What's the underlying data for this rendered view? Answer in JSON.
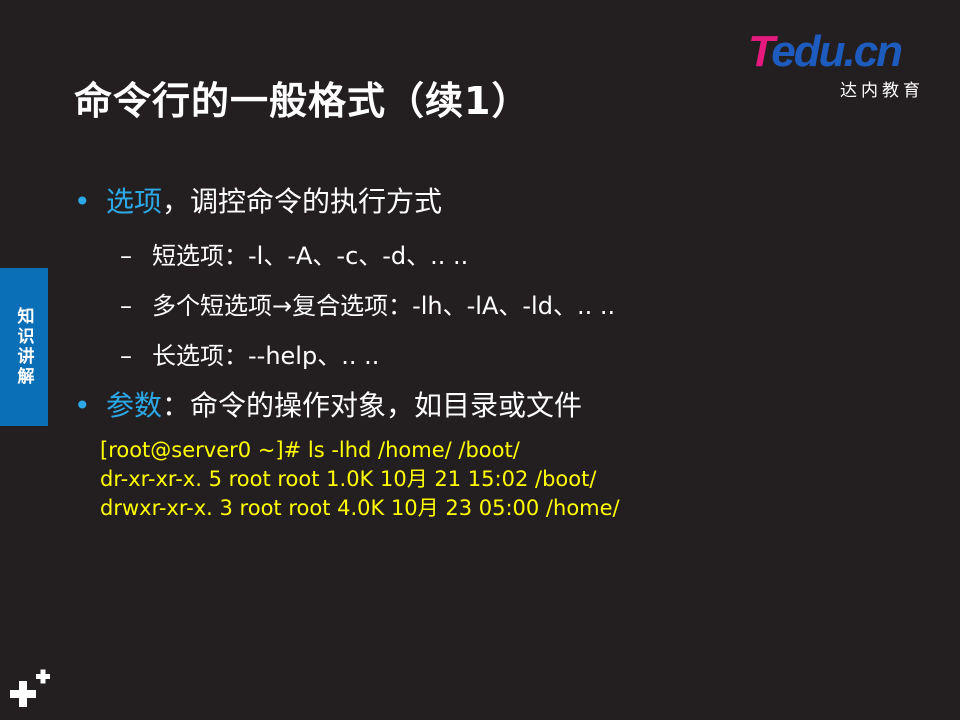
{
  "slide": {
    "title": "命令行的一般格式（续1）"
  },
  "logo": {
    "brand_letter": "T",
    "brand_rest": "edu.cn",
    "subtitle": "达内教育"
  },
  "side_tab": {
    "label": "知识讲解"
  },
  "bullets": [
    {
      "marker": "•",
      "keyword": "选项",
      "text": "，调控命令的执行方式",
      "sub_items": [
        {
          "marker": "–",
          "text": "短选项：-l、-A、-c、-d、.. .."
        },
        {
          "marker": "–",
          "text": "多个短选项→复合选项：-lh、-lA、-ld、.. .."
        },
        {
          "marker": "–",
          "text": "长选项：--help、.. .."
        }
      ]
    },
    {
      "marker": "•",
      "keyword": "参数",
      "text": "：命令的操作对象，如目录或文件"
    }
  ],
  "code": {
    "lines": [
      "[root@server0 ~]# ls  -lhd  /home/  /boot/",
      "dr-xr-xr-x. 5 root root 1.0K 10月 21 15:02 /boot/",
      "drwxr-xr-x. 3 root root 4.0K 10月 23 05:00 /home/"
    ]
  },
  "colors": {
    "background": "#231f20",
    "accent_blue": "#2ca8e6",
    "code_yellow": "#ffff00",
    "tab_blue": "#0a6fb6",
    "logo_magenta": "#e5197e",
    "logo_blue": "#1d5bbf"
  },
  "icons": {
    "corner": "plus-cluster-icon"
  }
}
